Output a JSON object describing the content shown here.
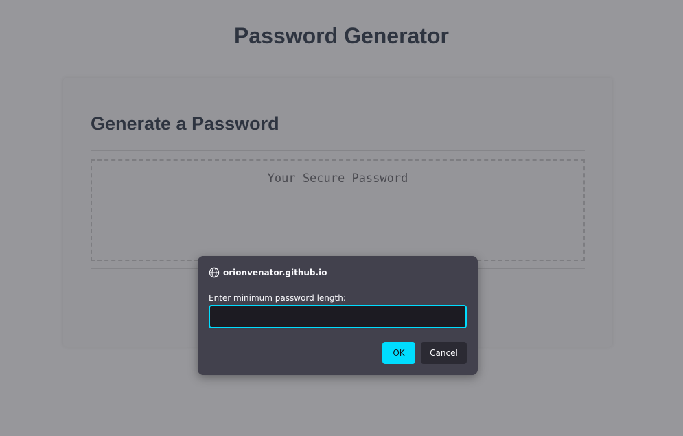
{
  "page": {
    "title": "Password Generator"
  },
  "card": {
    "header": "Generate a Password",
    "password_placeholder": "Your Secure Password"
  },
  "dialog": {
    "origin": "orionvenator.github.io",
    "message": "Enter minimum password length:",
    "input_value": "",
    "ok_label": "OK",
    "cancel_label": "Cancel",
    "icon": "globe-icon"
  },
  "colors": {
    "overlay_background": "#97979b",
    "dialog_background": "#42414d",
    "accent": "#00ddff",
    "heading_text": "#2e3440"
  }
}
